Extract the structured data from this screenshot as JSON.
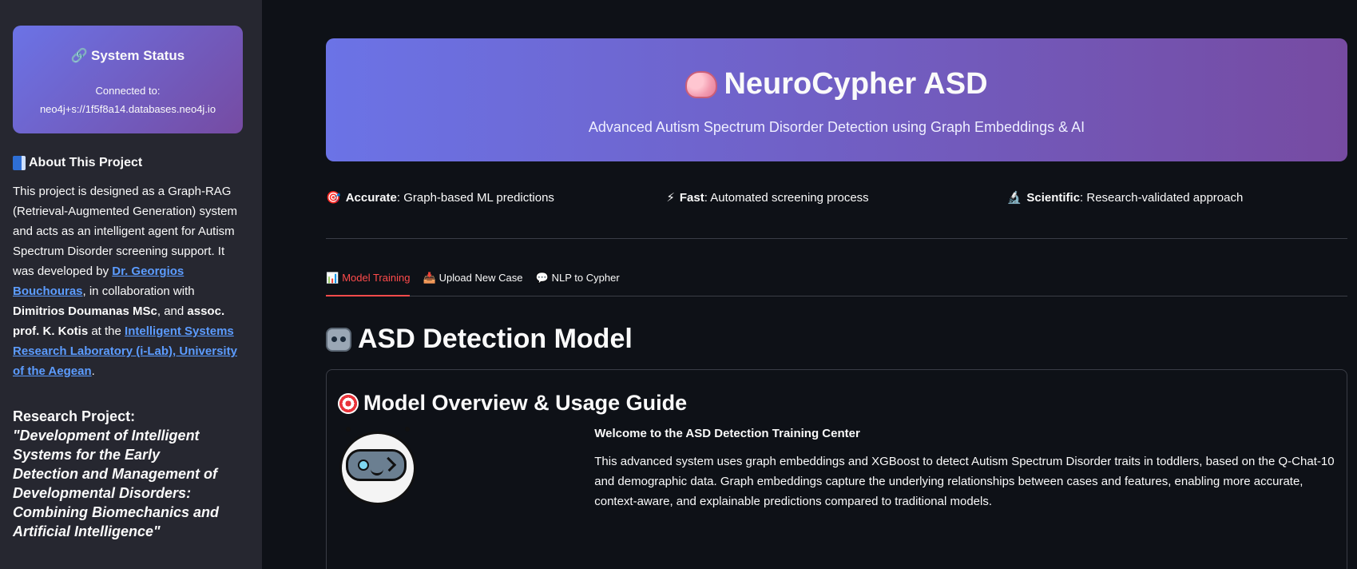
{
  "sidebar": {
    "status": {
      "icon": "link-icon",
      "title": "System Status",
      "connected_label": "Connected to:",
      "connection_uri": "neo4j+s://1f5f8a14.databases.neo4j.io"
    },
    "about": {
      "icon": "book-icon",
      "heading": "About This Project",
      "text_1": "This project is designed as a Graph-RAG (Retrieval-Augmented Generation) system and acts as an intelligent agent for Autism Spectrum Disorder screening support. It was developed by ",
      "link_author": "Dr. Georgios Bouchouras",
      "text_2": ", in collaboration with ",
      "bold_collab_1": "Dimitrios Doumanas MSc",
      "text_3": ", and ",
      "bold_collab_2": "assoc. prof. K. Kotis",
      "text_4": " at the ",
      "link_lab": "Intelligent Systems Research Laboratory (i-Lab), University of the Aegean",
      "text_5": "."
    },
    "research": {
      "label": "Research Project:",
      "title": "\"Development of Intelligent Systems for the Early Detection and Management of Developmental Disorders: Combining Biomechanics and Artificial Intelligence\""
    }
  },
  "hero": {
    "icon": "brain-icon",
    "title": "NeuroCypher ASD",
    "subtitle": "Advanced Autism Spectrum Disorder Detection using Graph Embeddings & AI",
    "colors": {
      "start": "#6b73e6",
      "end": "#764ba2"
    }
  },
  "features": [
    {
      "icon": "target-icon",
      "glyph": "🎯",
      "bold": "Accurate",
      "text": ": Graph-based ML predictions"
    },
    {
      "icon": "lightning-icon",
      "glyph": "⚡",
      "bold": "Fast",
      "text": ": Automated screening process"
    },
    {
      "icon": "microscope-icon",
      "glyph": "🔬",
      "bold": "Scientific",
      "text": ": Research-validated approach"
    }
  ],
  "tabs": [
    {
      "icon": "bar-chart-icon",
      "glyph": "📊",
      "label": "Model Training",
      "active": true
    },
    {
      "icon": "inbox-tray-icon",
      "glyph": "📥",
      "label": "Upload New Case",
      "active": false
    },
    {
      "icon": "speech-bubble-icon",
      "glyph": "💬",
      "label": "NLP to Cypher",
      "active": false
    }
  ],
  "main": {
    "section_icon": "robot-icon",
    "section_title": "ASD Detection Model",
    "card": {
      "icon": "target-icon",
      "title": "Model Overview & Usage Guide",
      "avatar_icon": "winking-robot-avatar-icon",
      "welcome": "Welcome to the ASD Detection Training Center",
      "description": "This advanced system uses graph embeddings and XGBoost to detect Autism Spectrum Disorder traits in toddlers, based on the Q-Chat-10 and demographic data. Graph embeddings capture the underlying relationships between cases and features, enabling more accurate, context-aware, and explainable predictions compared to traditional models."
    }
  },
  "theme": {
    "accent": "#ff4b4b",
    "link": "#5c9cff",
    "background": "#0e1117",
    "sidebar": "#262730"
  }
}
